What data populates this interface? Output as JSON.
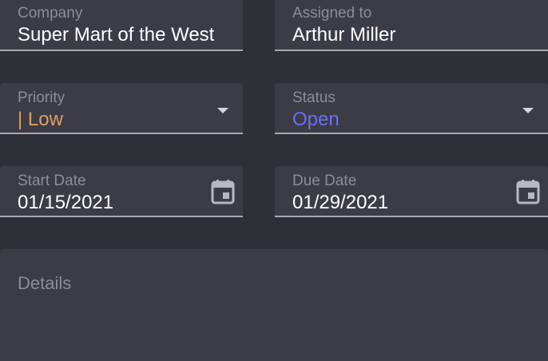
{
  "form": {
    "company": {
      "label": "Company",
      "value": "Super Mart of the West"
    },
    "assigned_to": {
      "label": "Assigned to",
      "value": "Arthur Miller"
    },
    "priority": {
      "label": "Priority",
      "value": "| Low",
      "color": "#e0a060"
    },
    "status": {
      "label": "Status",
      "value": "Open",
      "color": "#6b6ef0"
    },
    "start_date": {
      "label": "Start Date",
      "value": "01/15/2021",
      "icon": "calendar-icon"
    },
    "due_date": {
      "label": "Due Date",
      "value": "01/29/2021",
      "icon": "calendar-icon"
    },
    "details": {
      "label": "Details"
    }
  }
}
